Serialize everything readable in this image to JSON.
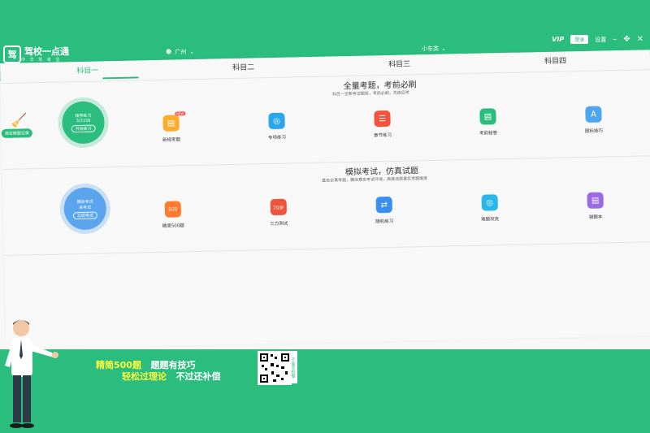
{
  "app": {
    "logo_mark": "驾",
    "title": "驾校一点通",
    "subtitle": "中 华 驾 考 宝",
    "city": "广州",
    "car_type": "小车类",
    "vip": "VIP",
    "login": "登录",
    "settings": "设置"
  },
  "tabs": [
    "科目一",
    "科目二",
    "科目三",
    "科目四"
  ],
  "sections": [
    {
      "title": "全量考题，考前必刷",
      "subtitle": "科目一全新考试题库，考前必刷，先练后考",
      "circle": {
        "title": "顺序练习",
        "progress": "3/2158",
        "button": "开始练习"
      },
      "items": [
        {
          "label": "新规考题",
          "badge": "NEW"
        },
        {
          "label": "专项练习"
        },
        {
          "label": "章节练习"
        },
        {
          "label": "考前秘卷"
        },
        {
          "label": "图标技巧"
        }
      ]
    },
    {
      "title": "模拟考试，仿真试题",
      "subtitle": "直击全真考题，模拟真实考试环境，高度还原真实考题难度",
      "circle": {
        "title": "模拟考试",
        "progress": "未考试",
        "button": "立即考试"
      },
      "items": [
        {
          "label": "精简500题",
          "icon_text": "500"
        },
        {
          "label": "三力测试",
          "icon_text": "70岁"
        },
        {
          "label": "随机练习"
        },
        {
          "label": "难题攻克"
        },
        {
          "label": "错题本"
        }
      ]
    }
  ],
  "clear_record": "清空做题记录",
  "promo": {
    "line1a": "精简500题",
    "line1b": "题题有技巧",
    "line2a": "轻松过理论",
    "line2b": "不过还补偿",
    "qr_label": "下载手机版"
  }
}
